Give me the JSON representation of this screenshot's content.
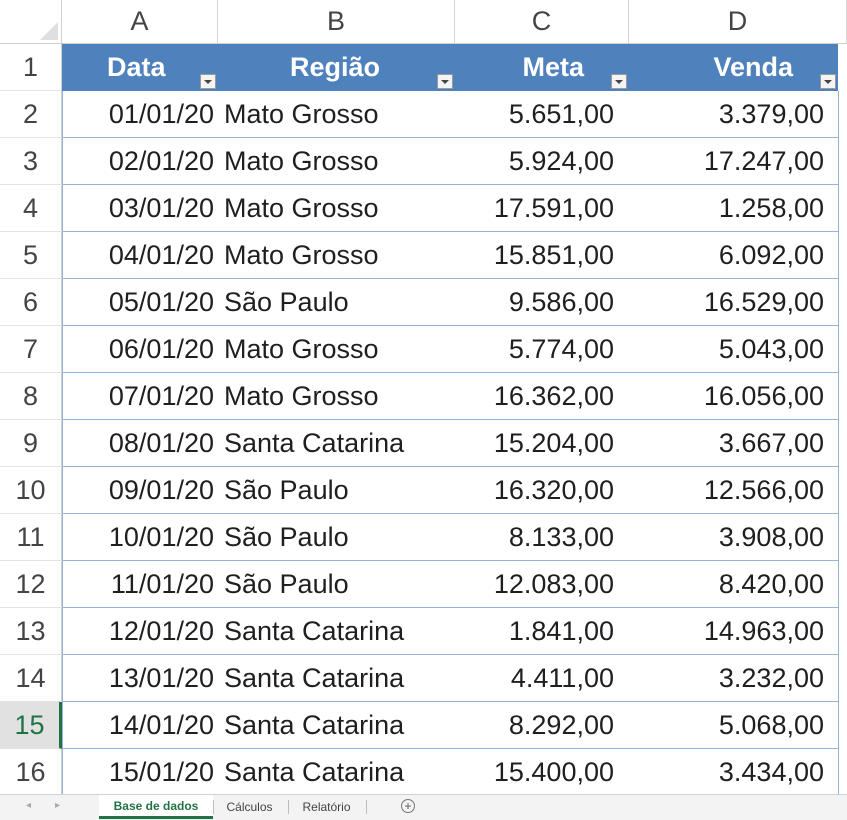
{
  "columns": [
    "A",
    "B",
    "C",
    "D"
  ],
  "row_numbers": [
    "1",
    "2",
    "3",
    "4",
    "5",
    "6",
    "7",
    "8",
    "9",
    "10",
    "11",
    "12",
    "13",
    "14",
    "15",
    "16"
  ],
  "selected_row": "15",
  "table": {
    "headers": [
      "Data",
      "Região",
      "Meta",
      "Venda"
    ],
    "rows": [
      [
        "01/01/20",
        "Mato Grosso",
        "5.651,00",
        "3.379,00"
      ],
      [
        "02/01/20",
        "Mato Grosso",
        "5.924,00",
        "17.247,00"
      ],
      [
        "03/01/20",
        "Mato Grosso",
        "17.591,00",
        "1.258,00"
      ],
      [
        "04/01/20",
        "Mato Grosso",
        "15.851,00",
        "6.092,00"
      ],
      [
        "05/01/20",
        "São Paulo",
        "9.586,00",
        "16.529,00"
      ],
      [
        "06/01/20",
        "Mato Grosso",
        "5.774,00",
        "5.043,00"
      ],
      [
        "07/01/20",
        "Mato Grosso",
        "16.362,00",
        "16.056,00"
      ],
      [
        "08/01/20",
        "Santa Catarina",
        "15.204,00",
        "3.667,00"
      ],
      [
        "09/01/20",
        "São Paulo",
        "16.320,00",
        "12.566,00"
      ],
      [
        "10/01/20",
        "São Paulo",
        "8.133,00",
        "3.908,00"
      ],
      [
        "11/01/20",
        "São Paulo",
        "12.083,00",
        "8.420,00"
      ],
      [
        "12/01/20",
        "Santa Catarina",
        "1.841,00",
        "14.963,00"
      ],
      [
        "13/01/20",
        "Santa Catarina",
        "4.411,00",
        "3.232,00"
      ],
      [
        "14/01/20",
        "Santa Catarina",
        "8.292,00",
        "5.068,00"
      ],
      [
        "15/01/20",
        "Santa Catarina",
        "15.400,00",
        "3.434,00"
      ]
    ]
  },
  "sheet_tabs": [
    {
      "label": "Base de dados",
      "active": true
    },
    {
      "label": "Cálculos",
      "active": false
    },
    {
      "label": "Relatório",
      "active": false
    }
  ],
  "add_sheet_label": "+",
  "colors": {
    "table_header": "#4f81bd",
    "table_border": "#95b3d7",
    "excel_green": "#217346"
  },
  "icons": [
    "scroll-left-icon",
    "scroll-right-icon",
    "filter-dropdown-icon",
    "add-sheet-icon",
    "select-all-icon"
  ]
}
